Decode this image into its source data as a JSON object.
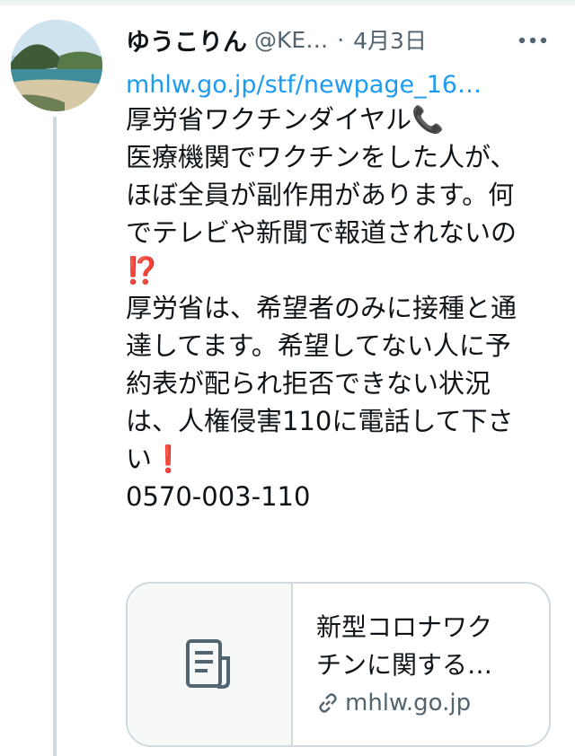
{
  "tweet": {
    "author_name": "ゆうこりん",
    "handle": "@KE…",
    "separator": "·",
    "date": "4月3日",
    "link_text": "mhlw.go.jp/stf/newpage_16…",
    "lines": [
      "厚労省ワクチンダイヤル📞",
      "医療機関でワクチンをした人が、",
      "ほぼ全員が副作用があります。何",
      "でテレビや新聞で報道されないの",
      "⁉️",
      "",
      "厚労省は、希望者のみに接種と通",
      "達してます。希望してない人に予",
      "約表が配られ拒否できない状況",
      "は、人権侵害110に電話して下さ",
      "い❗️",
      "0570-003-110"
    ]
  },
  "card": {
    "title_line1": "新型コロナワク",
    "title_line2": "チンに関する…",
    "domain": "mhlw.go.jp",
    "icons": {
      "thumb": "document-icon",
      "domain": "link-icon"
    }
  },
  "colors": {
    "link": "#1d9bf0",
    "muted": "#536471",
    "border": "#cfd9de"
  }
}
